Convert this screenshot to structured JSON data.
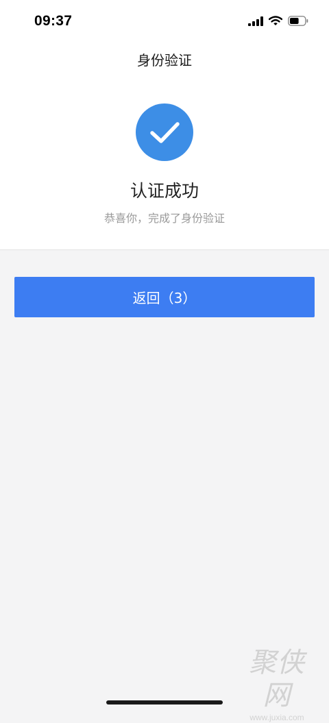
{
  "status_bar": {
    "time": "09:37",
    "icons": [
      "cellular-signal-icon",
      "wifi-icon",
      "battery-icon"
    ],
    "battery_level": 0.6
  },
  "header": {
    "title": "身份验证"
  },
  "result": {
    "icon": "check-icon",
    "icon_color": "#3d8ee6",
    "title": "认证成功",
    "subtitle": "恭喜你，完成了身份验证"
  },
  "actions": {
    "back_label": "返回（3）",
    "button_color": "#3d7df2"
  },
  "watermark": {
    "logo": "聚侠网",
    "url": "www.juxia.com"
  }
}
